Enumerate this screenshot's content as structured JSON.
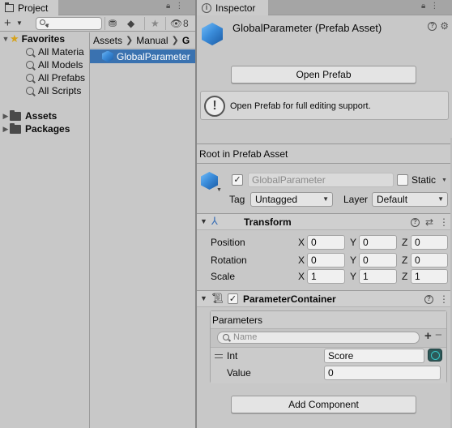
{
  "project_window": {
    "tab_title": "Project",
    "hidden_count": "8",
    "favorites": {
      "label": "Favorites",
      "items": [
        "All Materia",
        "All Models",
        "All Prefabs",
        "All Scripts"
      ]
    },
    "roots": [
      "Assets",
      "Packages"
    ],
    "breadcrumb": [
      "Assets",
      "Manual",
      "G"
    ],
    "selected_asset": "GlobalParameter"
  },
  "inspector": {
    "tab_title": "Inspector",
    "asset_title": "GlobalParameter (Prefab Asset)",
    "open_prefab_button": "Open Prefab",
    "help_message": "Open Prefab for full editing support.",
    "root_label": "Root in Prefab Asset",
    "gameobject": {
      "name": "GlobalParameter",
      "static_label": "Static",
      "tag_label": "Tag",
      "tag_value": "Untagged",
      "layer_label": "Layer",
      "layer_value": "Default"
    },
    "transform": {
      "title": "Transform",
      "rows": [
        {
          "label": "Position",
          "x": "0",
          "y": "0",
          "z": "0"
        },
        {
          "label": "Rotation",
          "x": "0",
          "y": "0",
          "z": "0"
        },
        {
          "label": "Scale",
          "x": "1",
          "y": "1",
          "z": "1"
        }
      ],
      "axes": [
        "X",
        "Y",
        "Z"
      ]
    },
    "parameter_container": {
      "title": "ParameterContainer",
      "list_label": "Parameters",
      "search_placeholder": "Name",
      "item": {
        "type_label": "Int",
        "key_value": "Score",
        "value_label": "Value",
        "value_value": "0"
      }
    },
    "add_component_button": "Add Component"
  },
  "colors": {
    "selection": "#3a72b0",
    "panel_bg": "#c8c8c8",
    "star": "#d6a21a"
  }
}
